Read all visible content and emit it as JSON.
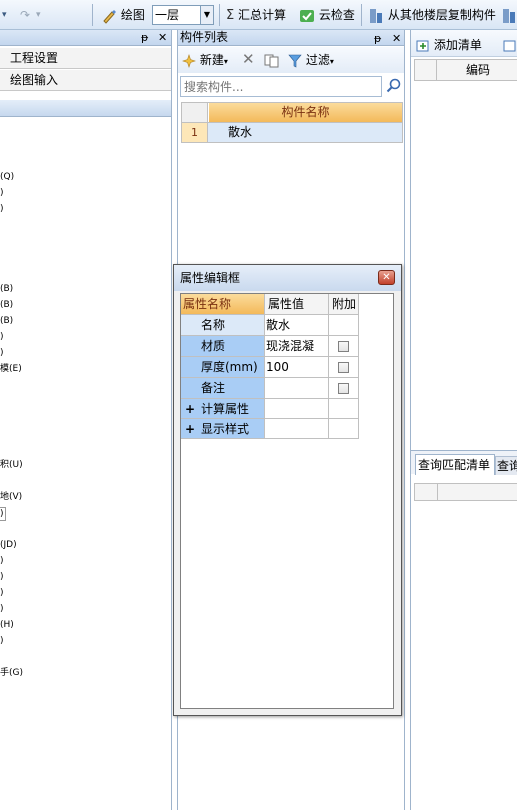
{
  "toolbar": {
    "draw_label": "绘图",
    "floor_value": "一层",
    "sum_label": "汇总计算",
    "cloud_check_label": "云检查",
    "copy_floor_label": "从其他楼层复制构件"
  },
  "left_panel": {
    "pin_icon": "ᵽ",
    "close_icon": "✕",
    "menu_items": [
      "工程设置",
      "绘图输入"
    ],
    "tree_fragments": [
      "(Q)",
      ")",
      ")",
      "(B)",
      "(B)",
      "(B)",
      ")",
      ")",
      "模(E)",
      "积(U)",
      "地(V)",
      ")",
      "(JD)",
      ")",
      ")",
      ")",
      ")",
      "(H)",
      ")",
      "手(G)"
    ]
  },
  "component_list": {
    "title": "构件列表",
    "pin_icon": "ᵽ",
    "close_icon": "✕",
    "new_label": "新建",
    "filter_label": "过滤",
    "search_placeholder": "搜索构件...",
    "column_header": "构件名称",
    "rows": [
      {
        "index": "1",
        "name": "散水"
      }
    ]
  },
  "right_panel": {
    "add_list_label": "添加清单",
    "column_code": "编码",
    "tab_match": "查询匹配清单",
    "tab_query": "查询"
  },
  "property_dialog": {
    "title": "属性编辑框",
    "close_icon": "✕",
    "headers": {
      "name": "属性名称",
      "value": "属性值",
      "extra": "附加"
    },
    "rows": [
      {
        "name": "名称",
        "value": "散水",
        "checkbox": false
      },
      {
        "name": "材质",
        "value": "现浇混凝",
        "checkbox": true
      },
      {
        "name": "厚度(mm)",
        "value": "100",
        "checkbox": true
      },
      {
        "name": "备注",
        "value": "",
        "checkbox": true
      },
      {
        "name": "计算属性",
        "value": "",
        "checkbox": false,
        "expand": "+"
      },
      {
        "name": "显示样式",
        "value": "",
        "checkbox": false,
        "expand": "+"
      }
    ]
  },
  "colors": {
    "header_orange": "#f7c97a",
    "row_blue": "#a9cdf5",
    "selected_row": "#dce9f8",
    "panel_title": "#c3d6ee"
  }
}
